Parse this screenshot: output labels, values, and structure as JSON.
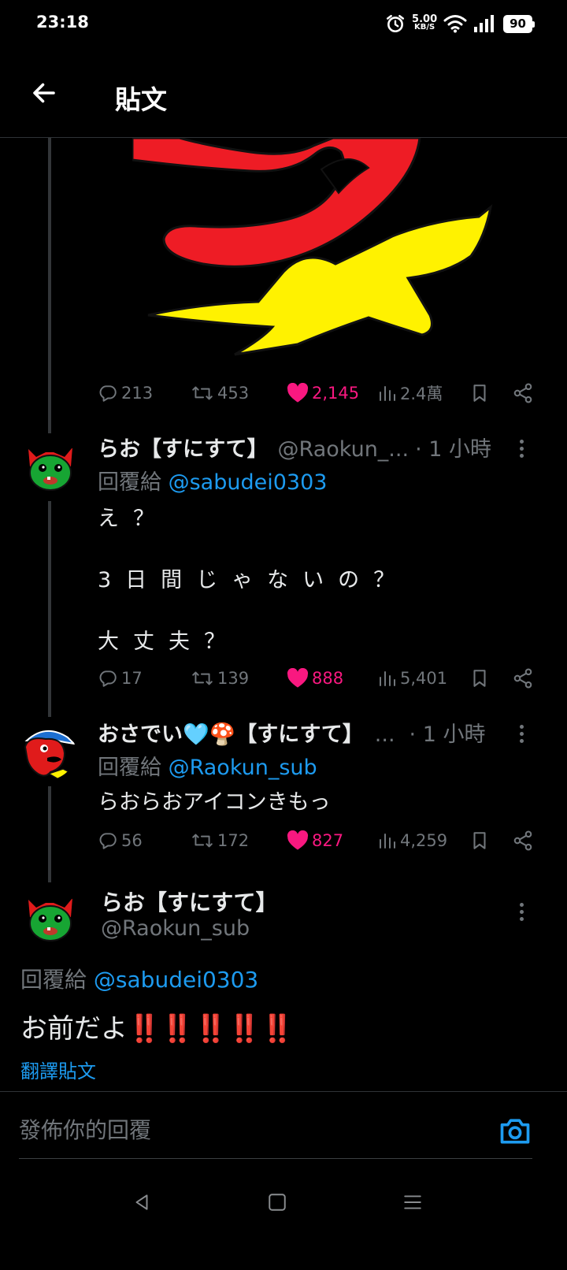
{
  "status_bar": {
    "time": "23:18",
    "net_speed_value": "5.00",
    "net_speed_unit": "KB/S",
    "battery": "90"
  },
  "header": {
    "title": "貼文"
  },
  "image_post": {
    "stats": {
      "replies": "213",
      "retweets": "453",
      "likes": "2,145",
      "views": "2.4萬"
    }
  },
  "reply_1": {
    "name": "らお【すにすて】",
    "handle": "@Raokun_...",
    "time": "· 1 小時",
    "reply_label": "回覆給",
    "reply_to": "@sabudei0303",
    "lines": [
      "え？",
      "3日間じゃないの？",
      "大丈夫？"
    ],
    "stats": {
      "replies": "17",
      "retweets": "139",
      "likes": "888",
      "views": "5,401"
    }
  },
  "reply_2": {
    "name": "おさでい🩵🍄【すにすて】",
    "handle": "...",
    "time": "· 1 小時",
    "reply_label": "回覆給",
    "reply_to": "@Raokun_sub",
    "text": "らおらおアイコンきもっ",
    "stats": {
      "replies": "56",
      "retweets": "172",
      "likes": "827",
      "views": "4,259"
    }
  },
  "main_post": {
    "name": "らお【すにすて】",
    "handle": "@Raokun_sub",
    "reply_label": "回覆給",
    "reply_to": "@sabudei0303",
    "text": "お前だよ‼️‼️‼️‼️‼️",
    "translate": "翻譯貼文"
  },
  "composer": {
    "placeholder": "發佈你的回覆"
  },
  "icons": [
    "back-arrow-icon",
    "alarm-icon",
    "wifi-icon",
    "signal-icon",
    "battery-icon",
    "reply-icon",
    "retweet-icon",
    "heart-icon",
    "views-icon",
    "bookmark-icon",
    "share-icon",
    "more-icon",
    "camera-icon",
    "nav-back-icon",
    "nav-home-icon",
    "nav-menu-icon"
  ],
  "colors": {
    "background": "#000000",
    "text": "#e7e9ea",
    "muted": "#71767b",
    "link": "#1d9bf0",
    "like": "#f91880"
  }
}
